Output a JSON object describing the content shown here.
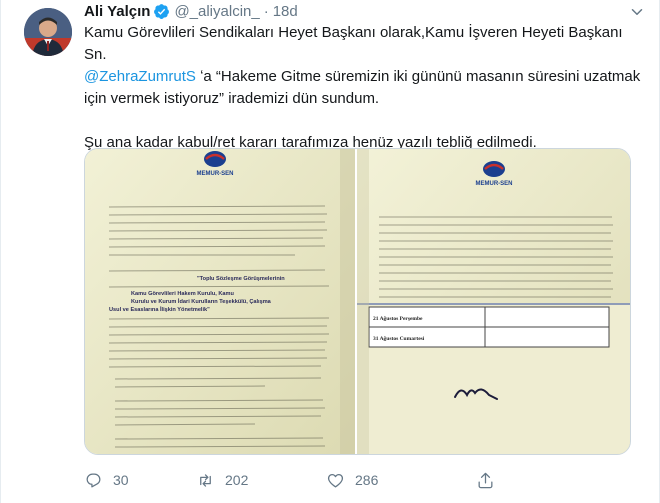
{
  "tweet": {
    "author_name": "Ali Yalçın",
    "handle": "@_aliyalcin_",
    "separator": "·",
    "time": "18d",
    "lines": [
      "Kamu Görevlileri Sendikaları Heyet Başkanı olarak,Kamu İşveren Heyeti Başkanı Sn.",
      "ʻa “Hakeme Gitme süremizin iki gününü masanın süresini uzatmak",
      "için vermek istiyoruz” irademizi dün sundum.",
      "Şu ana kadar kabul/ret kararı tarafımıza henüz yazılı tebliğ edilmedi."
    ],
    "mention": "@ZehraZumrutS"
  },
  "media": {
    "left_photo": {
      "logo_text": "MEMUR-SEN",
      "bold_lines": [
        "\"Toplu Sözleşme Görüşmelerinin",
        "Kamu Görevlileri Hakem Kurulu, Kamu",
        "Kurulu ve Kurum İdari Kurulların Teşekkülü, Çalışma",
        "Usul ve Esaslarına İlişkin Yönetmelik\""
      ]
    },
    "right_photo": {
      "logo_text": "MEMUR-SEN",
      "table_rows": [
        "21 Ağustos Perşembe",
        "31 Ağustos Cumartesi"
      ]
    }
  },
  "actions": {
    "reply_count": "30",
    "retweet_count": "202",
    "like_count": "286"
  },
  "colors": {
    "text": "#14171a",
    "secondary": "#657786",
    "link": "#1b95e0",
    "verified": "#1da1f2"
  }
}
